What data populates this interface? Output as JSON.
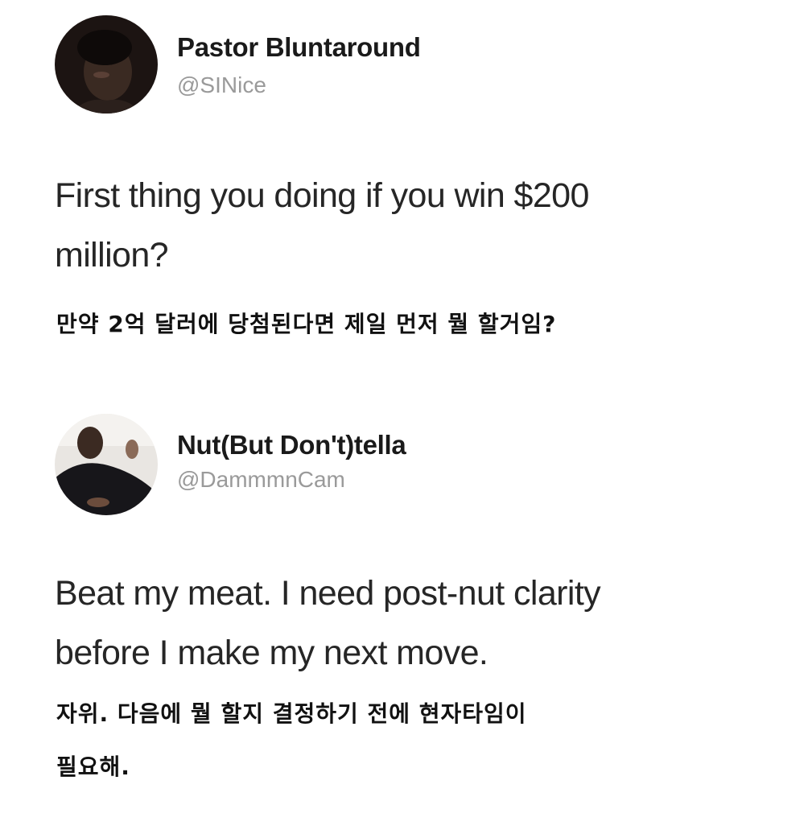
{
  "tweets": [
    {
      "display_name": "Pastor Bluntaround",
      "handle": "@SINice",
      "text_lines": [
        "First thing you doing if you win $200",
        "million?"
      ],
      "translation_lines": [
        "만약 2억 달러에 당첨된다면 제일 먼저 뭘 할거임?"
      ]
    },
    {
      "display_name": "Nut(But Don't)tella",
      "handle": "@DammmnCam",
      "text_lines": [
        "Beat my meat. I need post-nut clarity",
        "before I make my next move."
      ],
      "translation_lines": [
        "자위. 다음에 뭘 할지 결정하기 전에 현자타임이",
        "필요해."
      ]
    }
  ],
  "colors": {
    "text": "#262626",
    "handle": "#9a9a9a",
    "background": "#ffffff"
  },
  "icons": [
    "avatar-photo",
    "avatar-photo"
  ]
}
